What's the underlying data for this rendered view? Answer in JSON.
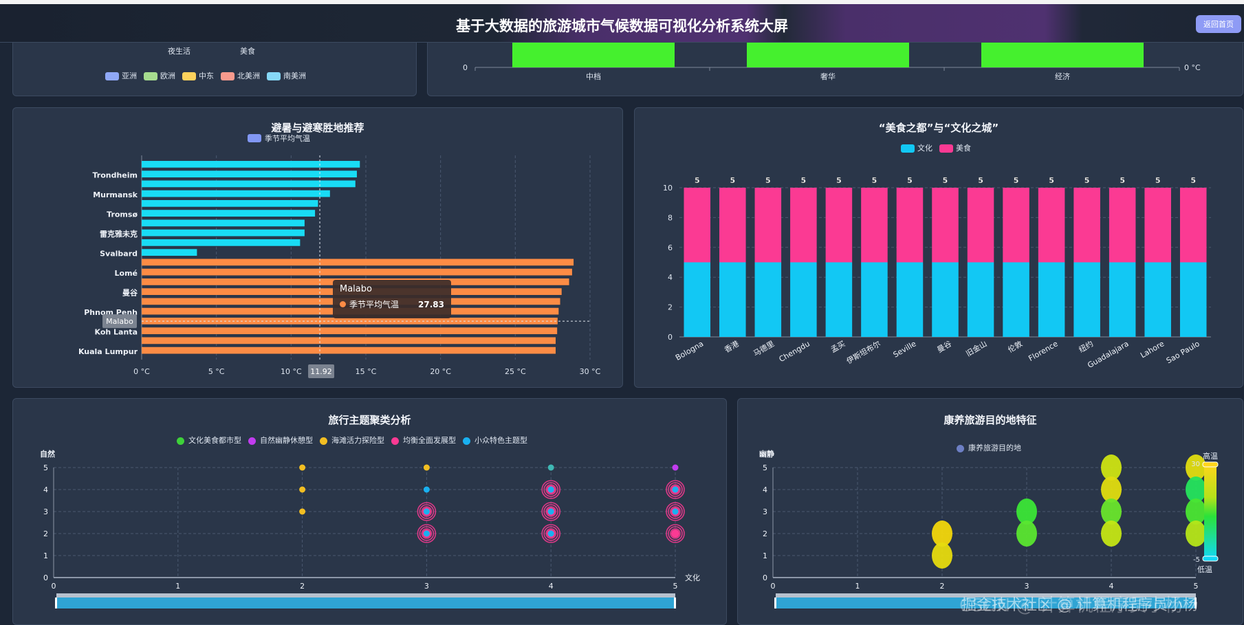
{
  "header": {
    "title": "基于大数据的旅游城市气候数据可视化分析系统大屏",
    "back_button": "返回首页"
  },
  "radar_panel": {
    "indicators": [
      "夜生活",
      "美食"
    ],
    "legend": [
      {
        "label": "亚洲",
        "color": "#8fa8f7"
      },
      {
        "label": "欧洲",
        "color": "#a6dc8f"
      },
      {
        "label": "中东",
        "color": "#fdd25c"
      },
      {
        "label": "北美洲",
        "color": "#f99a8d"
      },
      {
        "label": "南美洲",
        "color": "#86d8f7"
      }
    ]
  },
  "price_panel": {
    "y_left_tick": "0",
    "y_right_tick": "0 °C",
    "categories": [
      "中档",
      "奢华",
      "经济"
    ],
    "bar_color": "#45f02e"
  },
  "retreat_panel": {
    "title": "避暑与避寒胜地推荐",
    "legend": "季节平均气温",
    "legend_color": "#8197f4",
    "tooltip": {
      "title": "Malabo",
      "series": "季节平均气温",
      "value": "27.83"
    },
    "pointer": {
      "x_label": "11.92",
      "y_label": "Malabo"
    },
    "chart_data": {
      "type": "bar",
      "orientation": "horizontal",
      "xlim": [
        0,
        30
      ],
      "xticks": [
        "0 °C",
        "5 °C",
        "10 °C",
        "15 °C",
        "20 °C",
        "25 °C",
        "30 °C"
      ],
      "categories_top_to_bottom": [
        "",
        "Trondheim",
        "",
        "Murmansk",
        "",
        "Tromsø",
        "",
        "雷克雅未克",
        "",
        "Svalbard",
        "",
        "Lomé",
        "",
        "曼谷",
        "",
        "Phnom Penh",
        "Malabo",
        "Koh Lanta",
        "",
        "Kuala Lumpur"
      ],
      "values_top_to_bottom": [
        14.6,
        14.4,
        14.3,
        12.6,
        11.8,
        11.6,
        10.9,
        10.9,
        10.6,
        3.7,
        28.9,
        28.8,
        28.6,
        28.1,
        28.0,
        27.9,
        27.83,
        27.8,
        27.7,
        27.7
      ],
      "cold_color": "#19dcf5",
      "hot_color": "#fd8c45",
      "cold_count": 10
    }
  },
  "food_culture_panel": {
    "title": "“美食之都”与“文化之城”",
    "chart_data": {
      "type": "bar",
      "stacked": true,
      "ylim": [
        0,
        10
      ],
      "yticks": [
        "0",
        "2",
        "4",
        "6",
        "8",
        "10"
      ],
      "categories": [
        "Bologna",
        "香港",
        "马德里",
        "Chengdu",
        "孟买",
        "伊斯坦布尔",
        "Seville",
        "曼谷",
        "旧金山",
        "伦敦",
        "Florence",
        "纽约",
        "Guadalajara",
        "Lahore",
        "Sao Paulo"
      ],
      "series": [
        {
          "name": "文化",
          "color": "#12c8f4",
          "values": [
            5,
            5,
            5,
            5,
            5,
            5,
            5,
            5,
            5,
            5,
            5,
            5,
            5,
            5,
            5
          ]
        },
        {
          "name": "美食",
          "color": "#fb3a93",
          "values": [
            5,
            5,
            5,
            5,
            5,
            5,
            5,
            5,
            5,
            5,
            5,
            5,
            5,
            5,
            5
          ]
        }
      ],
      "top_label": "5"
    }
  },
  "theme_panel": {
    "title": "旅行主题聚类分析",
    "chart_data": {
      "type": "scatter",
      "xlabel": "文化",
      "ylabel": "自然",
      "xlim": [
        0,
        5
      ],
      "ylim": [
        0,
        5
      ],
      "ticks": [
        "0",
        "1",
        "2",
        "3",
        "4",
        "5"
      ],
      "series": [
        {
          "name": "文化美食都市型",
          "color": "#3ed13a",
          "points": []
        },
        {
          "name": "自然幽静休憩型",
          "color": "#c13cef",
          "points": [
            [
              5,
              5
            ]
          ]
        },
        {
          "name": "海滩活力探险型",
          "color": "#f2be22",
          "points": [
            [
              2,
              5
            ],
            [
              2,
              4
            ],
            [
              2,
              3
            ],
            [
              3,
              5
            ]
          ]
        },
        {
          "name": "均衡全面发展型",
          "color": "#fb3a93",
          "points": [
            [
              3,
              3
            ],
            [
              3,
              2
            ],
            [
              4,
              4
            ],
            [
              4,
              3
            ],
            [
              4,
              2
            ],
            [
              5,
              4
            ],
            [
              5,
              3
            ],
            [
              5,
              2
            ]
          ]
        },
        {
          "name": "小众特色主题型",
          "color": "#19b0f0",
          "points": [
            [
              3,
              4
            ],
            [
              3,
              3
            ],
            [
              3,
              2
            ],
            [
              4,
              4
            ],
            [
              4,
              3
            ],
            [
              4,
              2
            ],
            [
              5,
              4
            ],
            [
              5,
              3
            ]
          ]
        }
      ],
      "extra_points": [
        {
          "point": [
            4,
            5
          ],
          "color": "#3fb8b4"
        }
      ]
    }
  },
  "wellness_panel": {
    "title": "康养旅游目的地特征",
    "chart_data": {
      "type": "scatter",
      "ylabel": "幽静",
      "legend": "康养旅游目的地",
      "legend_color": "#6d7fc4",
      "xlim": [
        0,
        5
      ],
      "ylim": [
        0,
        5
      ],
      "ticks": [
        "0",
        "1",
        "2",
        "3",
        "4",
        "5"
      ],
      "points": [
        {
          "x": 2,
          "y": 2,
          "t": 28
        },
        {
          "x": 2,
          "y": 1,
          "t": 26
        },
        {
          "x": 3,
          "y": 3,
          "t": 12
        },
        {
          "x": 3,
          "y": 2,
          "t": 14
        },
        {
          "x": 4,
          "y": 5,
          "t": 22
        },
        {
          "x": 4,
          "y": 4,
          "t": 25
        },
        {
          "x": 4,
          "y": 3,
          "t": 15
        },
        {
          "x": 4,
          "y": 2,
          "t": 21
        },
        {
          "x": 5,
          "y": 5,
          "t": 25
        },
        {
          "x": 5,
          "y": 4,
          "t": 8
        },
        {
          "x": 5,
          "y": 3,
          "t": 13
        },
        {
          "x": 5,
          "y": 2,
          "t": 20
        }
      ],
      "visual_map": {
        "max_label": "高温",
        "min_label": "低温",
        "max": "30",
        "min": "-5"
      }
    }
  },
  "watermark": {
    "line1": "掘金技术社区 @ 计算机程序员小杨",
    "line2": "CSDN @ 计算机程序员小杨"
  }
}
